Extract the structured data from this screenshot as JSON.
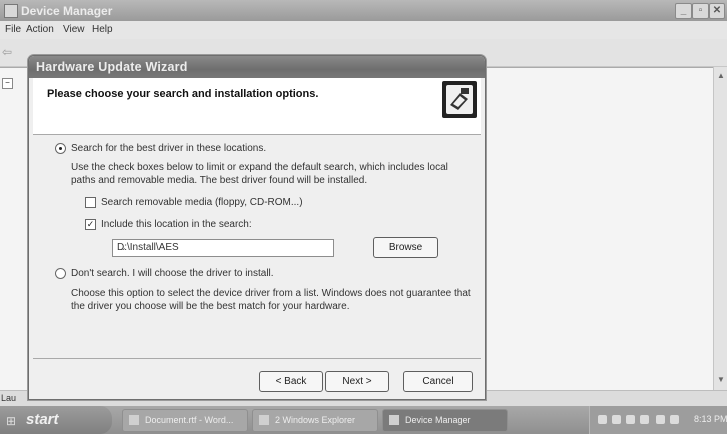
{
  "device_manager": {
    "title": "Device Manager",
    "menu": [
      "File",
      "Action",
      "View",
      "Help"
    ],
    "status_fragment": "Lau"
  },
  "wizard": {
    "title": "Hardware Update Wizard",
    "heading": "Please choose your search and installation options.",
    "option_search": {
      "label": "Search for the best driver in these locations.",
      "selected": true,
      "description_line1": "Use the check boxes below to limit or expand the default search, which includes local",
      "description_line2": "paths and removable media. The best driver found will be installed.",
      "removable_media": {
        "label": "Search removable media (floppy, CD-ROM...)",
        "checked": false
      },
      "include_location": {
        "label": "Include this location in the search:",
        "checked": true
      },
      "location_value": "D:\\Install\\AES",
      "browse_label": "Browse"
    },
    "option_manual": {
      "label": "Don't search. I will choose the driver to install.",
      "selected": false,
      "description_line1": "Choose this option to select the device driver from a list.  Windows does not guarantee that",
      "description_line2": "the driver you choose will be the best match for your hardware."
    },
    "buttons": {
      "back": "< Back",
      "next": "Next >",
      "cancel": "Cancel"
    }
  },
  "taskbar": {
    "start_label": "start",
    "tasks": [
      "Document.rtf - Word...",
      "2 Windows Explorer",
      "Device Manager"
    ],
    "clock": "8:13 PM"
  }
}
